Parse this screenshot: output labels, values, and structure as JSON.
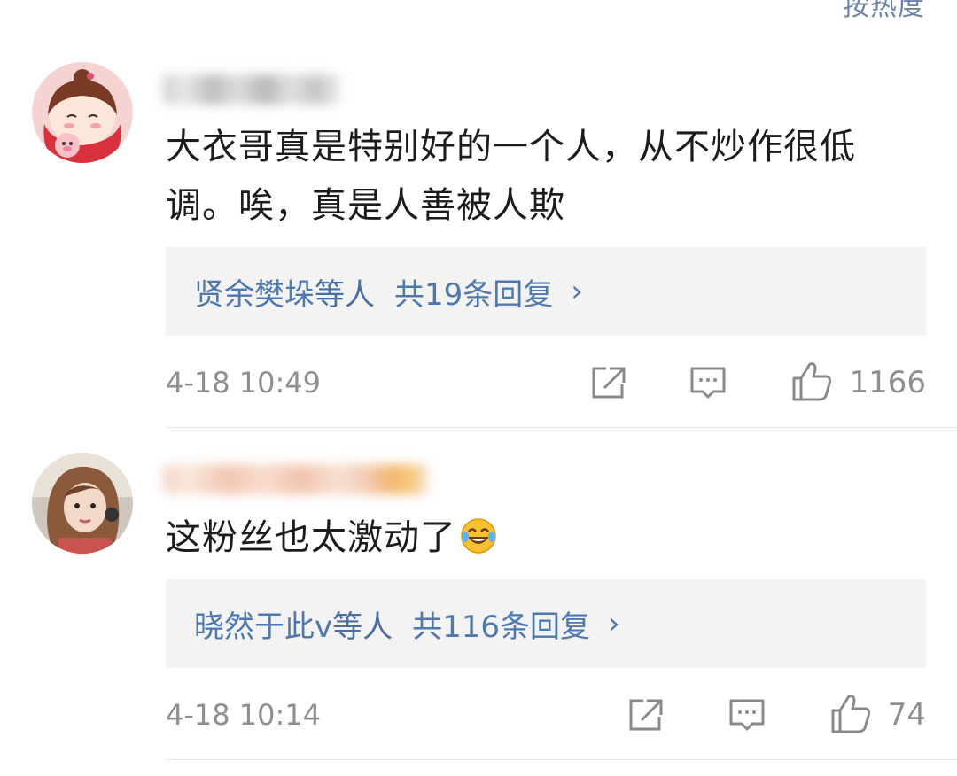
{
  "sort": {
    "label": "按热度"
  },
  "comments": [
    {
      "text": "大衣哥真是特别好的一个人，从不炒作很低调。唉，真是人善被人欺",
      "replies": {
        "names": "贤余樊垛",
        "others": "等人",
        "count": "共19条回复",
        "chevron": "›"
      },
      "timestamp": "4-18 10:49",
      "likes": "1166"
    },
    {
      "text": "这粉丝也太激动了",
      "emoji": "laughing-crying-emoji",
      "replies": {
        "names": "晓然于此v",
        "others": "等人",
        "count": "共116条回复",
        "chevron": "›"
      },
      "timestamp": "4-18 10:14",
      "likes": "74"
    }
  ],
  "icons": {
    "share": "share-icon",
    "comment": "comment-icon",
    "like": "thumbs-up-icon"
  },
  "colors": {
    "link": "#4f78ad",
    "meta": "#8f8f8f",
    "reply_bg": "#f3f3f3",
    "text": "#1c1c1c"
  }
}
